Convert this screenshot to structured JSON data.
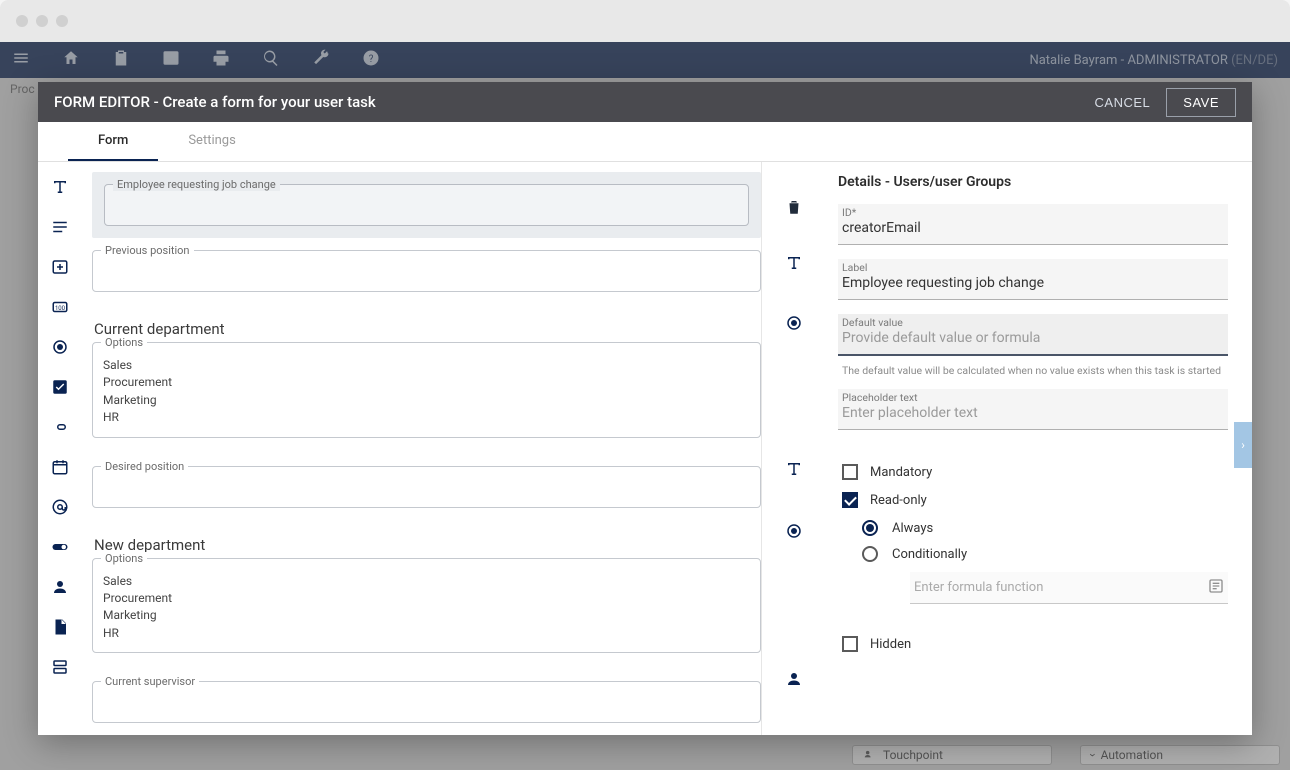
{
  "topbar": {
    "user": "Natalie Bayram - ADMINISTRATOR",
    "lang": "(EN/DE)"
  },
  "breadcrumb": "Proc",
  "modal": {
    "title": "FORM EDITOR - Create a form for your user task",
    "cancel": "CANCEL",
    "save": "SAVE"
  },
  "tabs": {
    "form": "Form",
    "settings": "Settings"
  },
  "canvas": {
    "fields": {
      "employee": {
        "label": "Employee requesting job change"
      },
      "previous": {
        "label": "Previous position"
      },
      "currentDept": {
        "title": "Current department",
        "optionsLabel": "Options",
        "options": "Sales\nProcurement\nMarketing\nHR"
      },
      "desired": {
        "label": "Desired position"
      },
      "newDept": {
        "title": "New department",
        "optionsLabel": "Options",
        "options": "Sales\nProcurement\nMarketing\nHR"
      },
      "supervisor": {
        "label": "Current supervisor"
      }
    }
  },
  "details": {
    "title": "Details - Users/user Groups",
    "id": {
      "label": "ID*",
      "value": "creatorEmail"
    },
    "labelField": {
      "label": "Label",
      "value": "Employee requesting job change"
    },
    "defaultValue": {
      "label": "Default value",
      "placeholder": "Provide default value or formula"
    },
    "defaultHint": "The default value will be calculated when no value exists when this task is started",
    "placeholderText": {
      "label": "Placeholder text",
      "placeholder": "Enter placeholder text"
    },
    "mandatory": "Mandatory",
    "readonly": "Read-only",
    "always": "Always",
    "conditionally": "Conditionally",
    "formulaPlaceholder": "Enter formula function",
    "hidden": "Hidden"
  },
  "bg": {
    "touchpoint": "Touchpoint",
    "automation": "Automation"
  }
}
